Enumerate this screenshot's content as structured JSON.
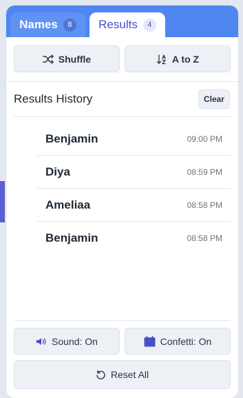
{
  "tabs": [
    {
      "label": "Names",
      "count": "8"
    },
    {
      "label": "Results",
      "count": "4"
    }
  ],
  "actions": {
    "shuffle": "Shuffle",
    "sort": "A to Z"
  },
  "history": {
    "title": "Results History",
    "clear": "Clear",
    "items": [
      {
        "name": "Benjamin",
        "time": "09:00 PM"
      },
      {
        "name": "Diya",
        "time": "08:59 PM"
      },
      {
        "name": "Ameliaa",
        "time": "08:58 PM"
      },
      {
        "name": "Benjamin",
        "time": "08:58 PM"
      }
    ]
  },
  "footer": {
    "sound": "Sound: On",
    "confetti": "Confetti: On",
    "reset": "Reset All"
  },
  "colors": {
    "accent": "#4a4fc7",
    "tabbar": "#4f86f0"
  }
}
